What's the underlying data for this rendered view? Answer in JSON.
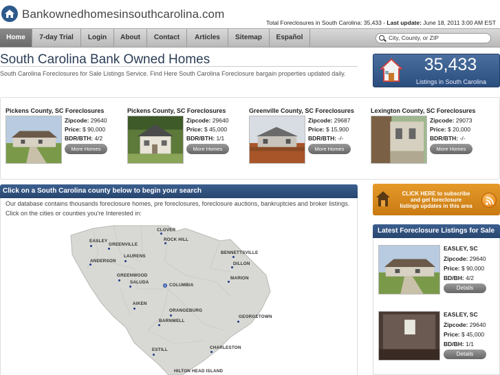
{
  "header": {
    "site_name": "Bankownedhomesinsouthcarolina.com",
    "stats_prefix": "Total Foreclosures in South Carolina: 35,433 - ",
    "update_label": "Last update:",
    "update_value": " June 18, 2011 3:00 AM EST"
  },
  "nav": {
    "items": [
      "Home",
      "7-day Trial",
      "Login",
      "About",
      "Contact",
      "Articles",
      "Sitemap",
      "Español"
    ],
    "active": "Home"
  },
  "search": {
    "placeholder": "City, County, or ZIP"
  },
  "intro": {
    "title": "South Carolina Bank Owned Homes",
    "description": "South Carolina Foreclosures for Sale Listings Service. Find Here South Carolina Foreclosure bargain properties updated daily."
  },
  "count_box": {
    "number": "35,433",
    "label": "Listings in South Carolina"
  },
  "listings": [
    {
      "title": "Pickens County, SC Foreclosures",
      "zip_label": "Zipcode:",
      "zip": " 29640",
      "price_label": "Price:",
      "price": " $ 90,000",
      "bdr_label": "BDR/BTH:",
      "bdr": " 4/2",
      "button": "More Homes"
    },
    {
      "title": "Pickens County, SC Foreclosures",
      "zip_label": "Zipcode:",
      "zip": " 29640",
      "price_label": "Price:",
      "price": " $ 45,000",
      "bdr_label": "BDR/BTH:",
      "bdr": " 1/1",
      "button": "More Homes"
    },
    {
      "title": "Greenville County, SC Foreclosures",
      "zip_label": "Zipcode:",
      "zip": " 29687",
      "price_label": "Price:",
      "price": " $ 15,900",
      "bdr_label": "BDR/BTH:",
      "bdr": " -/-",
      "button": "More Homes"
    },
    {
      "title": "Lexington County, SC Foreclosures",
      "zip_label": "Zipcode:",
      "zip": " 29073",
      "price_label": "Price:",
      "price": " $ 20,000",
      "bdr_label": "BDR/BTH:",
      "bdr": " -/-",
      "button": "More Homes"
    }
  ],
  "county_section": {
    "title": "Click on a South Carolina county below to begin your search",
    "description": "Our database contains thousands foreclosure homes, pre foreclosures, foreclosure auctions, bankruptcies and broker listings. Click on the cities or counties you're Interested in:",
    "cities": [
      "CLOVER",
      "ROCK HILL",
      "EASLEY",
      "GREENVILLE",
      "BENNETTSVILLE",
      "ANDERSON",
      "LAURENS",
      "DILLON",
      "GREENWOOD",
      "MARION",
      "SALUDA",
      "COLUMBIA",
      "AIKEN",
      "ORANGEBURG",
      "BARNWELL",
      "GEORGETOWN",
      "ESTILL",
      "CHARLESTON",
      "HILTON HEAD ISLAND"
    ]
  },
  "subscribe": {
    "line1": "CLICK HERE to subscribe",
    "line2": "and get foreclosure",
    "line3": "listings updates in this area"
  },
  "latest": {
    "title": "Latest Foreclosure Listings for Sale",
    "items": [
      {
        "city": "EASLEY, SC",
        "zip_label": "Zipcode:",
        "zip": " 29640",
        "price_label": "Price:",
        "price": " $ 90,000",
        "bd_label": "BD/BH:",
        "bd": " 4/2",
        "button": "Details"
      },
      {
        "city": "EASLEY, SC",
        "zip_label": "Zipcode:",
        "zip": " 29640",
        "price_label": "Price:",
        "price": " $ 45,000",
        "bd_label": "BD/BH:",
        "bd": " 1/1",
        "button": "Details"
      }
    ]
  },
  "colors": {
    "brand_blue": "#2b4a75",
    "accent_orange": "#d98a1c",
    "nav_gray": "#c8c8c8"
  }
}
